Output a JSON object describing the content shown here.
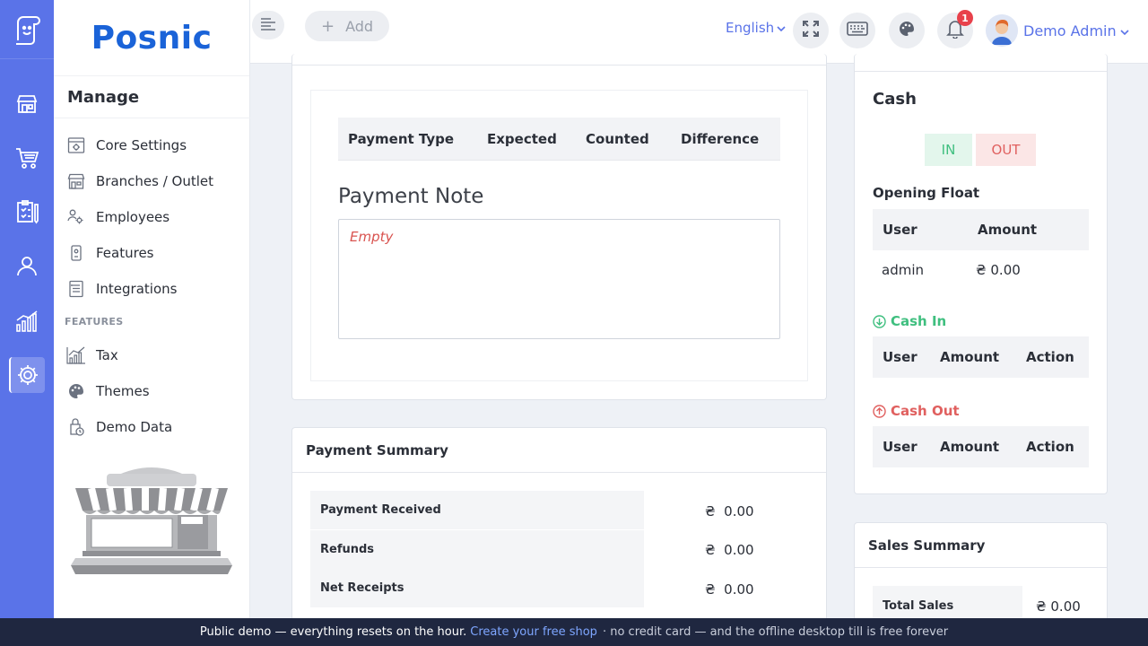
{
  "brand": {
    "name": "Posnic"
  },
  "topbar": {
    "add_label": "Add",
    "language": "English",
    "notifications_count": "1",
    "user_name": "Demo Admin"
  },
  "sidebar": {
    "section_title": "Manage",
    "items": [
      {
        "label": "Core Settings",
        "icon": "settings-panel-icon"
      },
      {
        "label": "Branches / Outlet",
        "icon": "store-icon"
      },
      {
        "label": "Employees",
        "icon": "employees-icon"
      },
      {
        "label": "Features",
        "icon": "feature-device-icon"
      },
      {
        "label": "Integrations",
        "icon": "integrations-icon"
      }
    ],
    "features_heading": "FEATURES",
    "feature_items": [
      {
        "label": "Tax",
        "icon": "tax-chart-icon"
      },
      {
        "label": "Themes",
        "icon": "palette-icon"
      },
      {
        "label": "Demo Data",
        "icon": "demo-data-icon"
      }
    ]
  },
  "rail": {
    "items": [
      "store-icon",
      "cart-icon",
      "clipboard-icon",
      "user-icon",
      "analytics-icon",
      "gear-icon"
    ],
    "active": "gear-icon"
  },
  "payment_table": {
    "headers": [
      "Payment Type",
      "Expected",
      "Counted",
      "Difference"
    ]
  },
  "payment_note": {
    "title": "Payment Note",
    "value": "Empty"
  },
  "payment_summary": {
    "title": "Payment Summary",
    "rows": [
      {
        "label": "Payment Received",
        "currency": "₴",
        "value": "0.00"
      },
      {
        "label": "Refunds",
        "currency": "₴",
        "value": "0.00"
      },
      {
        "label": "Net Receipts",
        "currency": "₴",
        "value": "0.00"
      }
    ]
  },
  "cash": {
    "title": "Cash",
    "in_label": "IN",
    "out_label": "OUT",
    "opening_float": {
      "title": "Opening Float",
      "headers": [
        "User",
        "Amount"
      ],
      "row": {
        "user": "admin",
        "amount": "₴ 0.00"
      }
    },
    "cash_in": {
      "title": "Cash In",
      "headers": [
        "User",
        "Amount",
        "Action"
      ]
    },
    "cash_out": {
      "title": "Cash Out",
      "headers": [
        "User",
        "Amount",
        "Action"
      ]
    }
  },
  "sales_summary": {
    "title": "Sales Summary",
    "rows": [
      {
        "label": "Total Sales",
        "value": "₴ 0.00"
      }
    ]
  },
  "footer": {
    "text_before": "Public demo — everything resets on the hour.",
    "link": "Create your free shop",
    "text_after": "· no credit card — and the offline desktop till is free forever"
  },
  "colors": {
    "primary": "#5a73e8",
    "brand_text": "#1a63d8",
    "success": "#3fbf7f",
    "danger": "#e0605f",
    "footer_bg": "#1f2740"
  }
}
